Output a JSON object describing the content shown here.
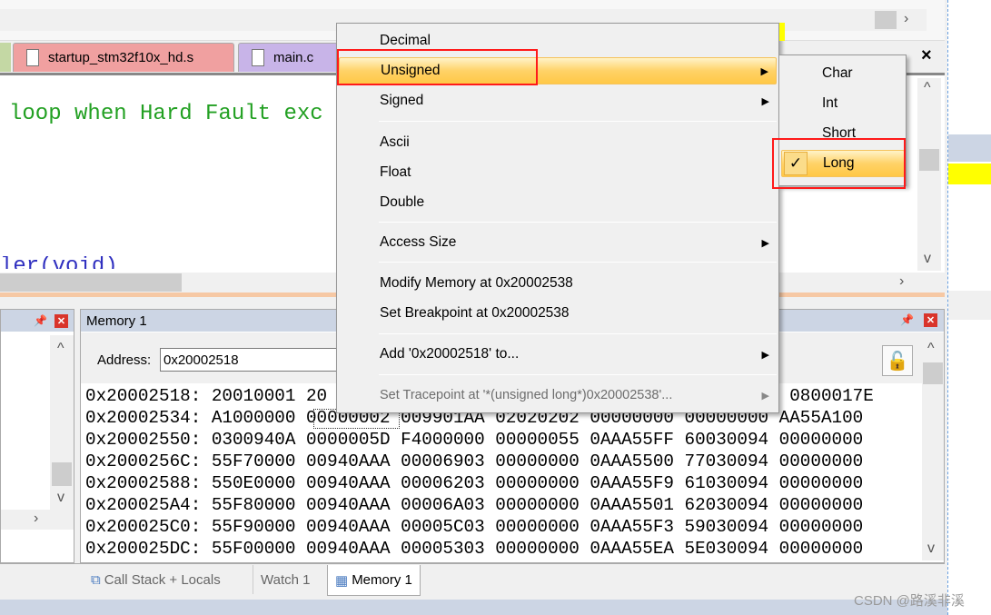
{
  "editor": {
    "tabs": [
      {
        "label": "startup_stm32f10x_hd.s",
        "color": "#f0a0a0"
      },
      {
        "label": "main.c",
        "color": "#c8b4e8"
      }
    ],
    "close_label": "×",
    "code_lines": [
      "loop when Hard Fault exc",
      "ler(void)"
    ]
  },
  "memory_panel": {
    "title": "Memory 1",
    "address_label": "Address:",
    "address_value": "0x20002518",
    "rows": [
      "0x20002518: 20010001 20                                          5 0800017E",
      "0x20002534: A1000000 00000002 009901AA 02020202 00000000 00000000 AA55A100",
      "0x20002550: 0300940A 0000005D F4000000 00000055 0AAA55FF 60030094 00000000",
      "0x2000256C: 55F70000 00940AAA 00006903 00000000 0AAA5500 77030094 00000000",
      "0x20002588: 550E0000 00940AAA 00006203 00000000 0AAA55F9 61030094 00000000",
      "0x200025A4: 55F80000 00940AAA 00006A03 00000000 0AAA5501 62030094 00000000",
      "0x200025C0: 55F90000 00940AAA 00005C03 00000000 0AAA55F3 59030094 00000000",
      "0x200025DC: 55F00000 00940AAA 00005303 00000000 0AAA55EA 5E030094 00000000"
    ]
  },
  "bottom_tabs": [
    {
      "label": "Call Stack + Locals"
    },
    {
      "label": "Watch 1"
    },
    {
      "label": "Memory 1",
      "selected": true
    }
  ],
  "context_menu": {
    "items": [
      {
        "label": "Decimal"
      },
      {
        "label": "Unsigned",
        "submenu": true,
        "highlighted": true
      },
      {
        "label": "Signed",
        "submenu": true
      },
      {
        "label": "Ascii"
      },
      {
        "label": "Float"
      },
      {
        "label": "Double"
      },
      {
        "label": "Access Size",
        "submenu": true
      },
      {
        "label": "Modify Memory at 0x20002538"
      },
      {
        "label": "Set Breakpoint at 0x20002538"
      },
      {
        "label": "Add '0x20002518' to...",
        "submenu": true
      },
      {
        "label": "Set Tracepoint at '*(unsigned long*)0x20002538'...",
        "submenu": true,
        "disabled": true
      }
    ]
  },
  "submenu": {
    "items": [
      {
        "label": "Char"
      },
      {
        "label": "Int"
      },
      {
        "label": "Short"
      },
      {
        "label": "Long",
        "checked": true,
        "highlighted": true
      }
    ],
    "check_glyph": "✓"
  },
  "watermark": "CSDN @路溪非溪",
  "colors": {
    "highlight": "#ffd267",
    "annotation_box": "#ff1a1a",
    "code_comment": "#22a022",
    "panel_header": "#ccd5e4"
  }
}
